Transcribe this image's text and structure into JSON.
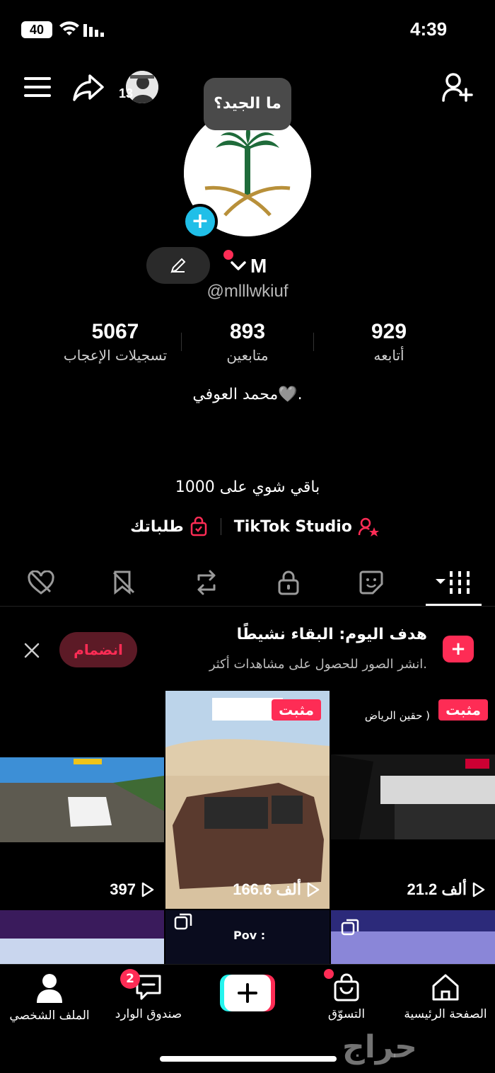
{
  "status_bar": {
    "time": "4:39",
    "battery": "40"
  },
  "header": {
    "avatar_count": "13",
    "tooltip": "ما الجيد؟"
  },
  "profile": {
    "display_name": "M",
    "username": "@mlllwkiuf",
    "stats": [
      {
        "value": "5067",
        "label": "تسجيلات الإعجاب"
      },
      {
        "value": "893",
        "label": "متابعين"
      },
      {
        "value": "929",
        "label": "أتابعه"
      }
    ],
    "bio": "محمد العوفي🩶.",
    "bio_line2": "باقي شوي على 1000",
    "links": {
      "studio": "TikTok Studio",
      "orders": "طلباتك"
    }
  },
  "goal": {
    "title": "هدف اليوم: البقاء نشيطًا",
    "subtitle": "انشر الصور للحصول على مشاهدات أكثر.",
    "join": "انضمام"
  },
  "videos": [
    {
      "views": "21.2 ألف",
      "pinned": "مثبت",
      "caption": "حقين الرياض )"
    },
    {
      "views": "166.6 ألف",
      "pinned": "مثبت",
      "caption": ""
    },
    {
      "views": "397",
      "pinned": "",
      "caption": ""
    }
  ],
  "videos_row2": {
    "middle_caption": "Pov :"
  },
  "bottom_nav": {
    "home": "الصفحة الرئيسية",
    "shop": "التسوّق",
    "inbox": "صندوق الوارد",
    "inbox_badge": "2",
    "profile": "الملف الشخصي"
  },
  "watermark": "حراج",
  "colors": {
    "accent": "#fe2c55",
    "cyan": "#20bfe8"
  }
}
